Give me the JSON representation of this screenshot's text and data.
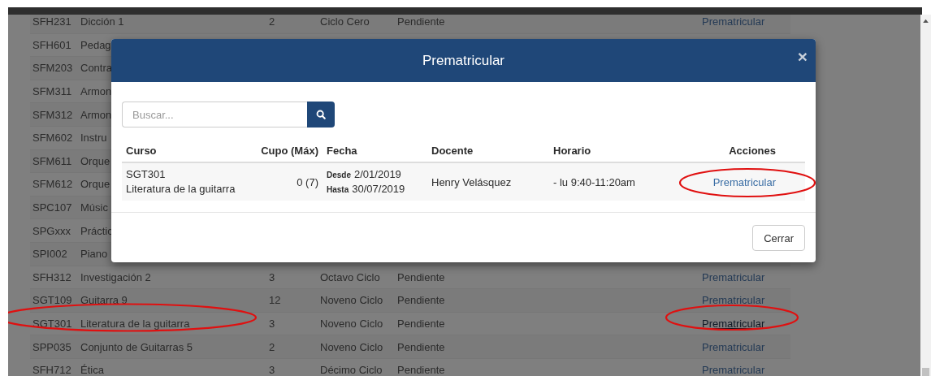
{
  "background_table": {
    "rows": [
      {
        "code": "SFH231",
        "name": "Dicción 1",
        "credits": "2",
        "cycle": "Ciclo Cero",
        "status": "Pendiente",
        "action": "Prematricular",
        "hovered": false,
        "circled": false
      },
      {
        "code": "SFH601",
        "name": "Pedag",
        "circled": false
      },
      {
        "code": "SFM203",
        "name": "Contra",
        "circled": false
      },
      {
        "code": "SFM311",
        "name": "Armon",
        "circled": false
      },
      {
        "code": "SFM312",
        "name": "Armon",
        "circled": false
      },
      {
        "code": "SFM602",
        "name": "Instru",
        "circled": false
      },
      {
        "code": "SFM611",
        "name": "Orque",
        "circled": false
      },
      {
        "code": "SFM612",
        "name": "Orque",
        "circled": false
      },
      {
        "code": "SPC107",
        "name": "Músic",
        "circled": false
      },
      {
        "code": "SPGxxx",
        "name": "Práctic",
        "circled": false
      },
      {
        "code": "SPI002",
        "name": "Piano",
        "circled": false
      },
      {
        "code": "SFH312",
        "name": "Investigación 2",
        "credits": "3",
        "cycle": "Octavo Ciclo",
        "status": "Pendiente",
        "action": "Prematricular",
        "hovered": false,
        "circled": false
      },
      {
        "code": "SGT109",
        "name": "Guitarra 9",
        "credits": "12",
        "cycle": "Noveno Ciclo",
        "status": "Pendiente",
        "action": "Prematricular",
        "hovered": false,
        "circled": false
      },
      {
        "code": "SGT301",
        "name": "Literatura de la guitarra",
        "credits": "3",
        "cycle": "Noveno Ciclo",
        "status": "Pendiente",
        "action": "Prematricular",
        "hovered": true,
        "circled": true
      },
      {
        "code": "SPP035",
        "name": "Conjunto de Guitarras 5",
        "credits": "2",
        "cycle": "Noveno Ciclo",
        "status": "Pendiente",
        "action": "Prematricular",
        "hovered": false,
        "circled": false
      },
      {
        "code": "SFH712",
        "name": "Ética",
        "credits": "3",
        "cycle": "Décimo Ciclo",
        "status": "Pendiente",
        "action": "Prematricular",
        "hovered": false,
        "circled": false
      }
    ]
  },
  "modal": {
    "title": "Prematricular",
    "close": "×",
    "search": {
      "placeholder": "Buscar..."
    },
    "columns": [
      "Curso",
      "Cupo (Máx)",
      "Fecha",
      "Docente",
      "Horario",
      "Acciones"
    ],
    "rows": [
      {
        "code": "SGT301",
        "name": "Literatura de la guitarra",
        "quota": "0 (7)",
        "from_label": "Desde",
        "from": "2/01/2019",
        "to_label": "Hasta",
        "to": "30/07/2019",
        "teacher": "Henry Velásquez",
        "schedule": "- lu 9:40-11:20am",
        "action": "Prematricular",
        "circled": true
      }
    ],
    "footer_button": "Cerrar"
  }
}
